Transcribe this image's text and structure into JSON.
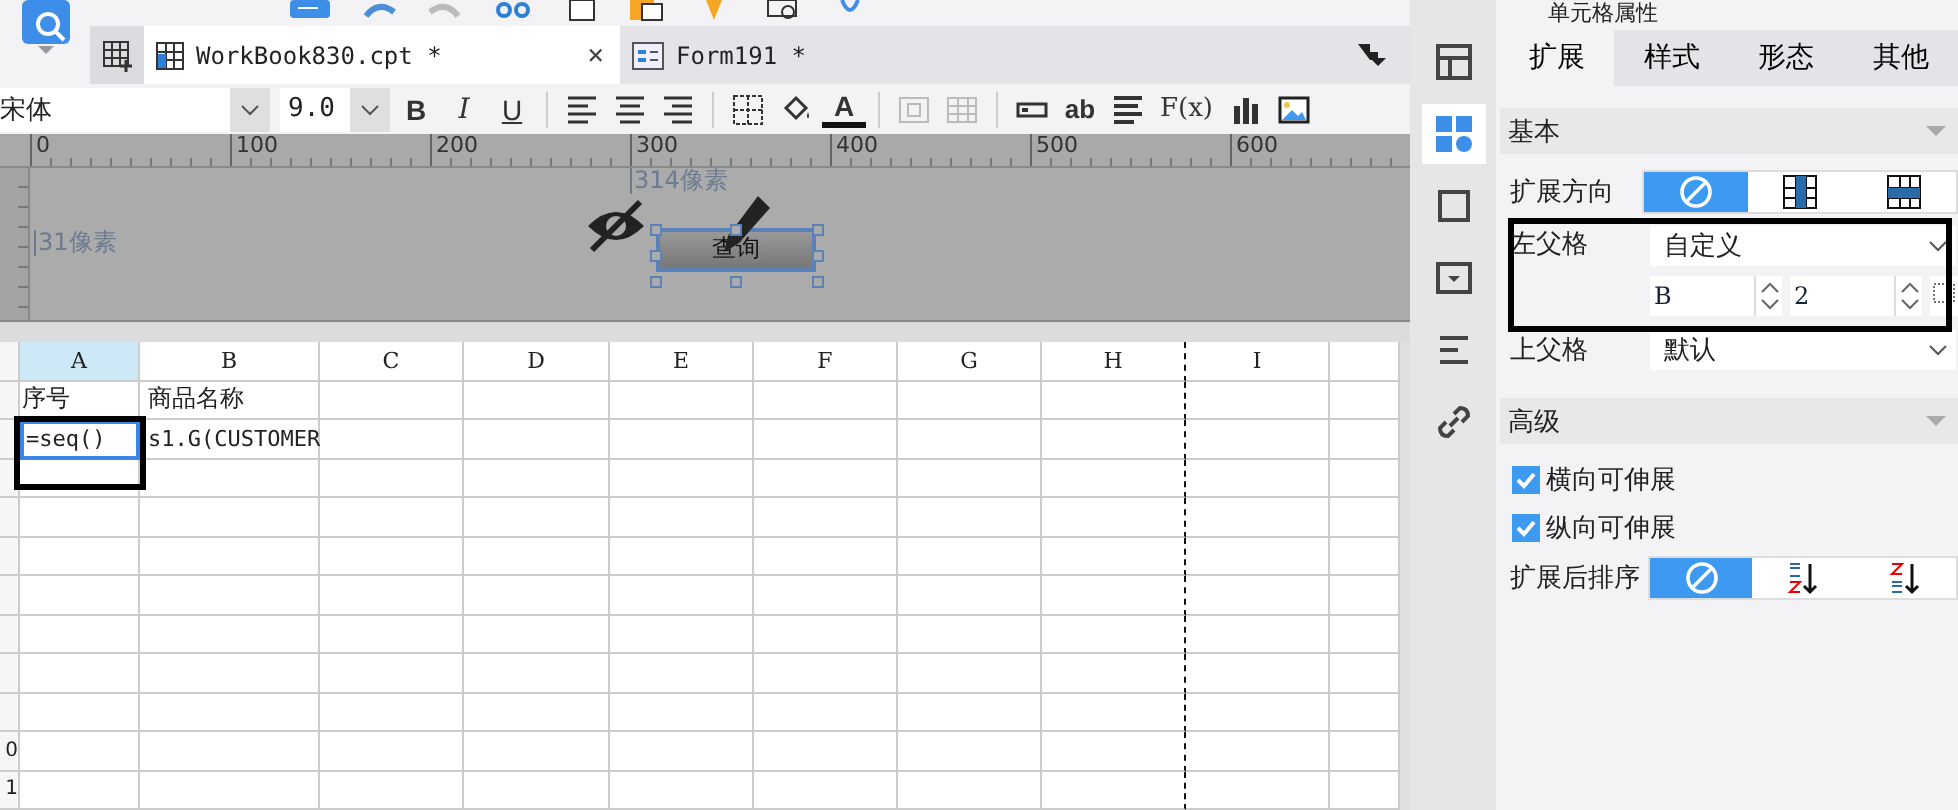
{
  "tabs": [
    {
      "label": "WorkBook830.cpt *",
      "selected": true,
      "close": "×"
    },
    {
      "label": "Form191 *",
      "selected": false
    }
  ],
  "format_bar": {
    "font": "宋体",
    "size": "9.0",
    "tool_groups": [
      [
        {
          "kind": "bold",
          "label": "B",
          "disabled": false
        },
        {
          "kind": "italic",
          "label": "I",
          "disabled": false
        },
        {
          "kind": "underline",
          "label": "U",
          "disabled": false
        }
      ],
      [
        {
          "kind": "align-left",
          "disabled": false
        },
        {
          "kind": "align-center",
          "disabled": false
        },
        {
          "kind": "align-right",
          "disabled": false
        }
      ],
      [
        {
          "kind": "border",
          "disabled": false
        },
        {
          "kind": "fill",
          "disabled": false
        },
        {
          "kind": "font-color",
          "label": "A",
          "disabled": false
        }
      ],
      [
        {
          "kind": "merge",
          "disabled": true
        },
        {
          "kind": "grid",
          "disabled": true
        }
      ],
      [
        {
          "kind": "text-field",
          "disabled": false
        },
        {
          "kind": "label",
          "label": "ab",
          "disabled": false
        },
        {
          "kind": "paragraph",
          "disabled": false
        },
        {
          "kind": "formula",
          "label": "F(x)",
          "disabled": false
        },
        {
          "kind": "chart",
          "disabled": false
        },
        {
          "kind": "image",
          "disabled": false
        }
      ]
    ]
  },
  "ruler": {
    "ticks": [
      "0",
      "100",
      "200",
      "300",
      "400",
      "500",
      "600"
    ]
  },
  "para_canvas": {
    "width_label": "314像素",
    "height_label": "31像素",
    "button": {
      "label": "查询",
      "selected": true
    }
  },
  "sheet": {
    "columns": [
      {
        "label": "A",
        "selected": true
      },
      {
        "label": "B",
        "selected": false
      },
      {
        "label": "C",
        "selected": false
      },
      {
        "label": "D",
        "selected": false
      },
      {
        "label": "E",
        "selected": false
      },
      {
        "label": "F",
        "selected": false
      },
      {
        "label": "G",
        "selected": false
      },
      {
        "label": "H",
        "selected": false
      },
      {
        "label": "I",
        "selected": false
      }
    ],
    "rows": [
      {
        "cells": [
          {
            "text": "序号",
            "selected": false
          },
          {
            "text": "商品名称",
            "selected": false
          }
        ]
      },
      {
        "cells": [
          {
            "text": "=seq()",
            "selected": true
          },
          {
            "text": "s1.G(CUSTOMER",
            "selected": false
          }
        ]
      },
      {
        "cells": []
      },
      {
        "cells": []
      },
      {
        "cells": []
      },
      {
        "cells": []
      },
      {
        "cells": []
      },
      {
        "cells": []
      },
      {
        "cells": []
      },
      {
        "label": "0",
        "cells": []
      },
      {
        "label": "1",
        "cells": []
      }
    ]
  },
  "side_tabs": [
    {
      "kind": "layout",
      "selected": false
    },
    {
      "kind": "cell",
      "selected": true
    },
    {
      "kind": "frame",
      "selected": false
    },
    {
      "kind": "widget",
      "selected": false
    },
    {
      "kind": "condition",
      "selected": false
    },
    {
      "kind": "link",
      "selected": false
    }
  ],
  "panel": {
    "title": "单元格属性",
    "tabs": [
      {
        "label": "扩展",
        "selected": true
      },
      {
        "label": "样式",
        "selected": false
      },
      {
        "label": "形态",
        "selected": false
      },
      {
        "label": "其他",
        "selected": false
      }
    ],
    "basic": {
      "title": "基本",
      "direction": {
        "label": "扩展方向",
        "options": [
          {
            "kind": "none",
            "selected": true
          },
          {
            "kind": "vertical",
            "selected": false
          },
          {
            "kind": "horizontal",
            "selected": false
          }
        ]
      },
      "left_parent": {
        "label": "左父格",
        "value": "自定义",
        "column": "B",
        "row": "2"
      },
      "top_parent": {
        "label": "上父格",
        "value": "默认"
      }
    },
    "advanced": {
      "title": "高级",
      "options": [
        {
          "label": "横向可伸展",
          "checked": true
        },
        {
          "label": "纵向可伸展",
          "checked": true
        }
      ],
      "sort": {
        "label": "扩展后排序",
        "options": [
          {
            "kind": "none",
            "selected": true
          },
          {
            "kind": "ascending",
            "selected": false
          },
          {
            "kind": "descending",
            "selected": false
          }
        ]
      }
    }
  }
}
